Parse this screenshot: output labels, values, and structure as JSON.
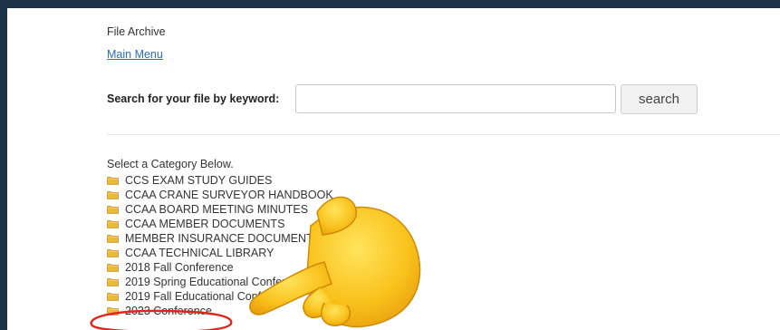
{
  "page": {
    "title": "File Archive",
    "main_menu_link": "Main Menu"
  },
  "search": {
    "label": "Search for your file by keyword:",
    "value": "",
    "placeholder": "",
    "button_label": "search"
  },
  "categories": {
    "heading": "Select a Category Below.",
    "items": [
      "CCS EXAM STUDY GUIDES",
      "CCAA CRANE SURVEYOR HANDBOOK",
      "CCAA BOARD MEETING MINUTES",
      "CCAA MEMBER DOCUMENTS",
      "MEMBER INSURANCE DOCUMENTS",
      "CCAA TECHNICAL LIBRARY",
      "2018 Fall Conference",
      "2019 Spring Educational Conference",
      "2019 Fall Educational Conference",
      "2023 Conference"
    ]
  },
  "annotations": {
    "highlight_color": "#e0261c",
    "pointer_icon": "backhand-index-pointing-left-emoji"
  },
  "colors": {
    "frame_background": "#1b3247",
    "link": "#2a6fb8",
    "folder": "#e8b840"
  }
}
